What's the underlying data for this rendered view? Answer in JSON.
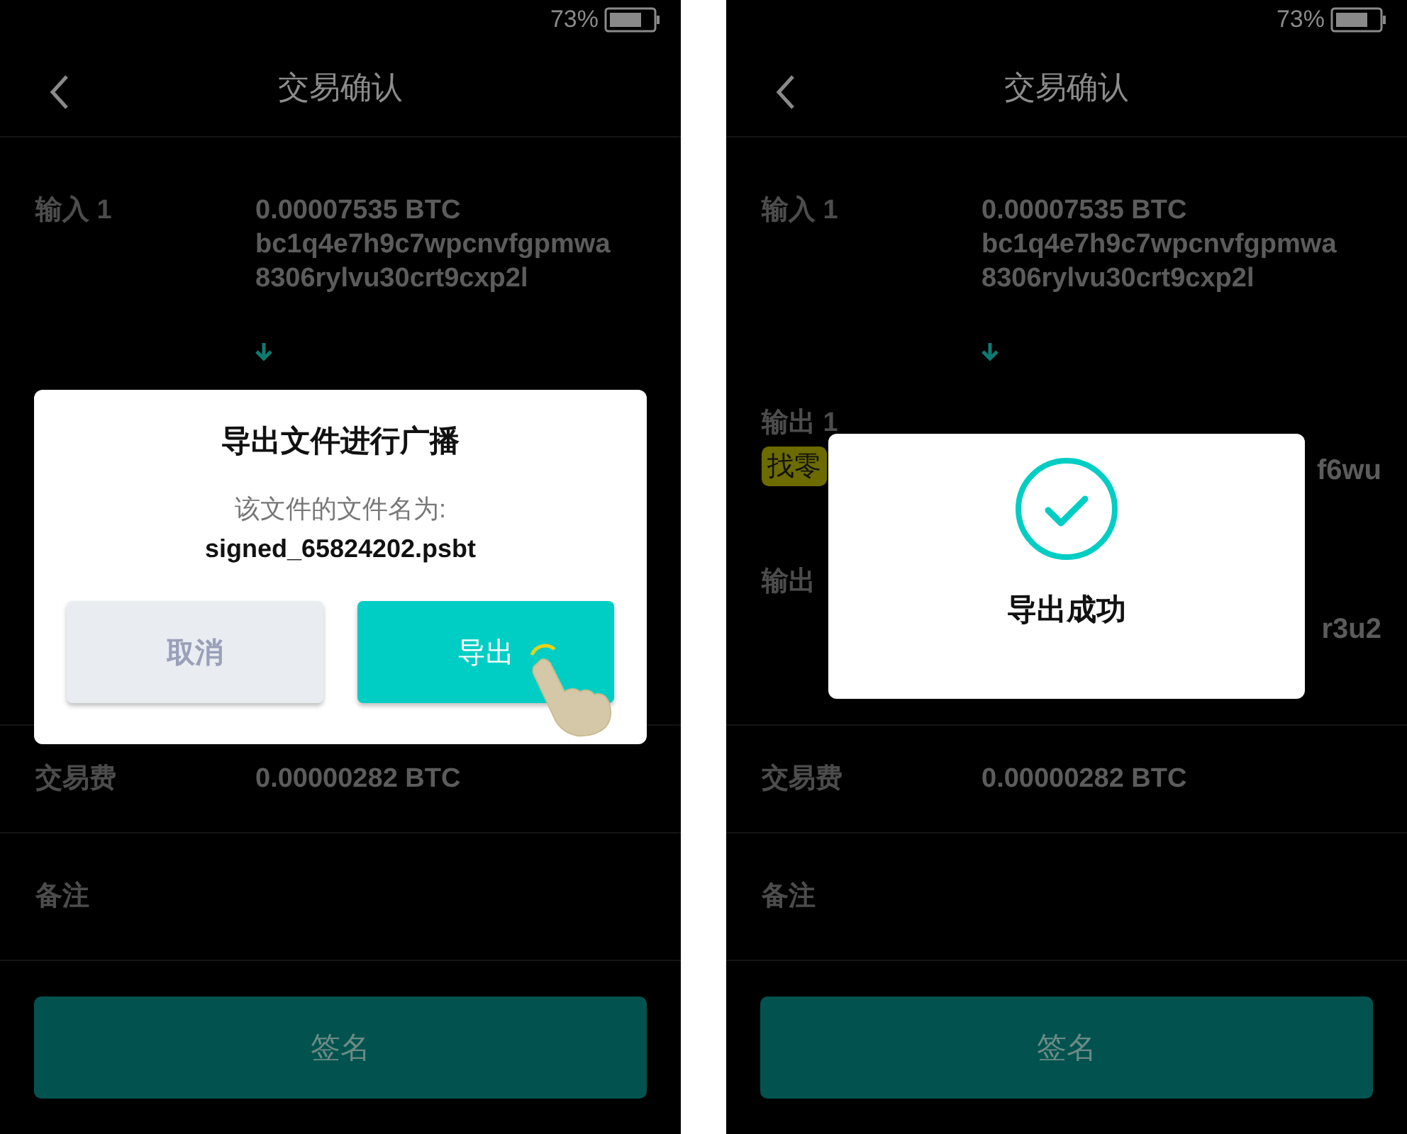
{
  "screens": [
    {
      "status_bar": {
        "battery": "73%"
      },
      "header": {
        "title": "交易确认"
      },
      "inputs": [
        {
          "label": "输入 1",
          "lines": [
            "0.00007535 BTC",
            "bc1q4e7h9c7wpcnvfgpmwa",
            "8306rylvu30crt9cxp2l"
          ]
        }
      ],
      "fee": {
        "label": "交易费",
        "value": "0.00000282 BTC"
      },
      "note": {
        "label": "备注"
      },
      "sign_button": "签名",
      "dialog": {
        "kind": "confirm",
        "title": "导出文件进行广播",
        "message": "该文件的文件名为:",
        "filename": "signed_65824202.psbt",
        "buttons": [
          {
            "label": "取消",
            "kind": "secondary"
          },
          {
            "label": "导出",
            "kind": "primary"
          }
        ]
      }
    },
    {
      "status_bar": {
        "battery": "73%"
      },
      "header": {
        "title": "交易确认"
      },
      "inputs": [
        {
          "label": "输入 1",
          "lines": [
            "0.00007535 BTC",
            "bc1q4e7h9c7wpcnvfgpmwa",
            "8306rylvu30crt9cxp2l"
          ]
        }
      ],
      "outputs": [
        {
          "label": "输出 1",
          "tag": "找零",
          "tail": "f6wu"
        },
        {
          "label": "输出",
          "tail": "r3u2"
        }
      ],
      "fee": {
        "label": "交易费",
        "value": "0.00000282 BTC"
      },
      "note": {
        "label": "备注"
      },
      "sign_button": "签名",
      "dialog": {
        "kind": "success",
        "message": "导出成功"
      }
    }
  ]
}
